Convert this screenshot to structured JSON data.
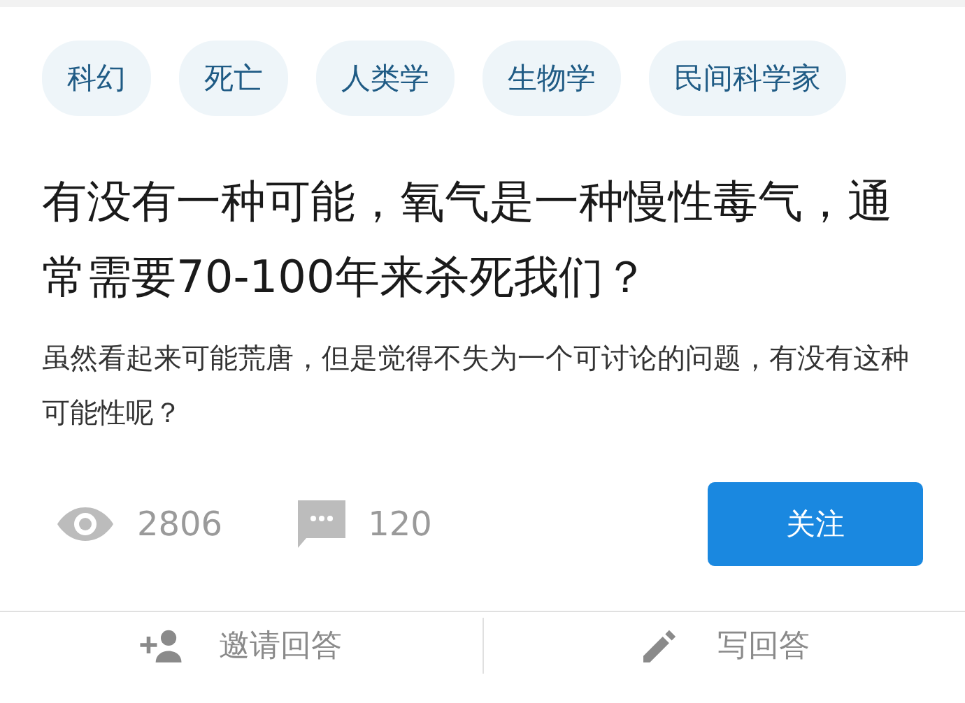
{
  "tags": [
    "科幻",
    "死亡",
    "人类学",
    "生物学",
    "民间科学家"
  ],
  "question": {
    "title": "有没有一种可能，氧气是一种慢性毒气，通常需要70-100年来杀死我们？",
    "description": "虽然看起来可能荒唐，但是觉得不失为一个可讨论的问题，有没有这种可能性呢？"
  },
  "stats": {
    "views": "2806",
    "comments": "120"
  },
  "follow_button": "关注",
  "actions": [
    {
      "kind": "invite",
      "label": "邀请回答"
    },
    {
      "kind": "write",
      "label": "写回答"
    }
  ]
}
